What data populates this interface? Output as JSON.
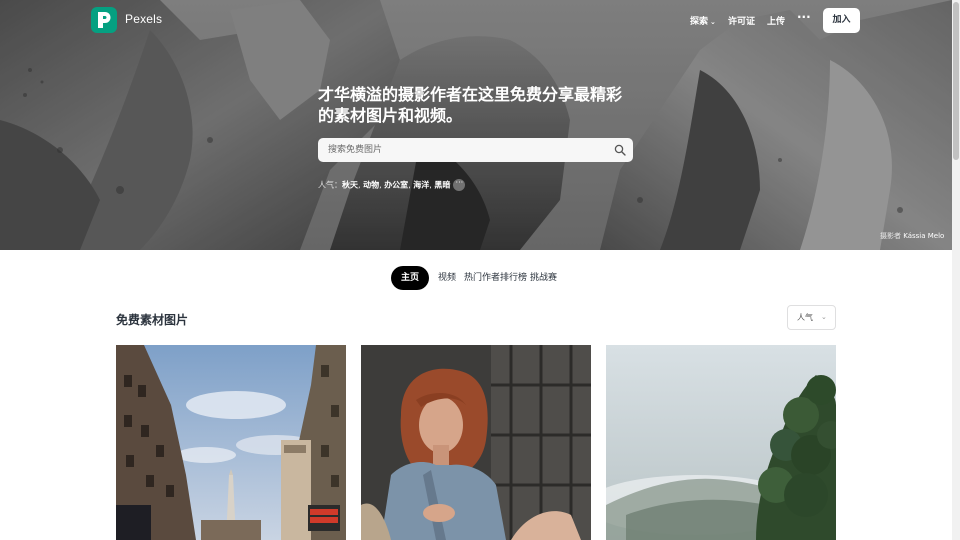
{
  "header": {
    "brand": "Pexels",
    "nav": {
      "explore": "探索",
      "license": "许可证",
      "upload": "上传",
      "more": "···"
    },
    "join_label": "加入"
  },
  "hero": {
    "headline_line1": "才华横溢的摄影作者在这里免费分享最精彩",
    "headline_line2": "的素材图片和视频。",
    "search_placeholder": "搜索免费图片",
    "popular_label": "人气：",
    "popular_tags": [
      "秋天",
      "动物",
      "办公室",
      "海洋",
      "黑暗"
    ],
    "popular_more": "···",
    "credit_prefix": "摄影者",
    "credit_name": "Kássia Melo"
  },
  "tabs": [
    {
      "label": "主页",
      "active": true
    },
    {
      "label": "视频",
      "active": false
    },
    {
      "label": "热门作者排行榜",
      "active": false
    },
    {
      "label": "挑战赛",
      "active": false
    }
  ],
  "section": {
    "title": "免费素材图片",
    "sort_value": "人气"
  },
  "photos": [
    {
      "name": "city-street-photo"
    },
    {
      "name": "woman-portrait-photo"
    },
    {
      "name": "misty-forest-photo"
    }
  ],
  "colors": {
    "brand": "#05a081",
    "text": "#2c343e",
    "active_tab": "#000000"
  }
}
